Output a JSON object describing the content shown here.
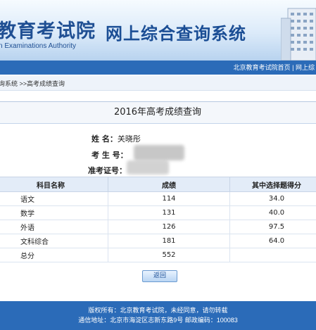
{
  "header": {
    "logo_text": "教育考试院",
    "logo_subtitle": "n Examinations Authority",
    "system_title": "网上综合查询系统"
  },
  "nav": {
    "links": "北京教育考试院首页 | 网上综"
  },
  "breadcrumb": {
    "text": "询系统 >>高考成绩查询"
  },
  "result": {
    "title": "2016年高考成绩查询",
    "name_label": "姓    名：",
    "name_value": "关晓彤",
    "exam_no_label": "考 生 号：",
    "id_label": "准考证号："
  },
  "table": {
    "headers": [
      "科目名称",
      "成绩",
      "其中选择题得分"
    ],
    "rows": [
      {
        "subject": "语文",
        "score": "114",
        "choice": "34.0"
      },
      {
        "subject": "数学",
        "score": "131",
        "choice": "40.0"
      },
      {
        "subject": "外语",
        "score": "126",
        "choice": "97.5"
      },
      {
        "subject": "文科综合",
        "score": "181",
        "choice": "64.0"
      },
      {
        "subject": "总分",
        "score": "552",
        "choice": ""
      }
    ]
  },
  "button": {
    "label": "返回"
  },
  "footer": {
    "line1": "版权所有：北京教育考试院，未经同意，请勿转载",
    "line2": "通信地址：北京市海淀区志新东路9号 邮政编码：100083"
  },
  "colors": {
    "brand": "#2b6bb8",
    "title_blue": "#1b4e95"
  }
}
